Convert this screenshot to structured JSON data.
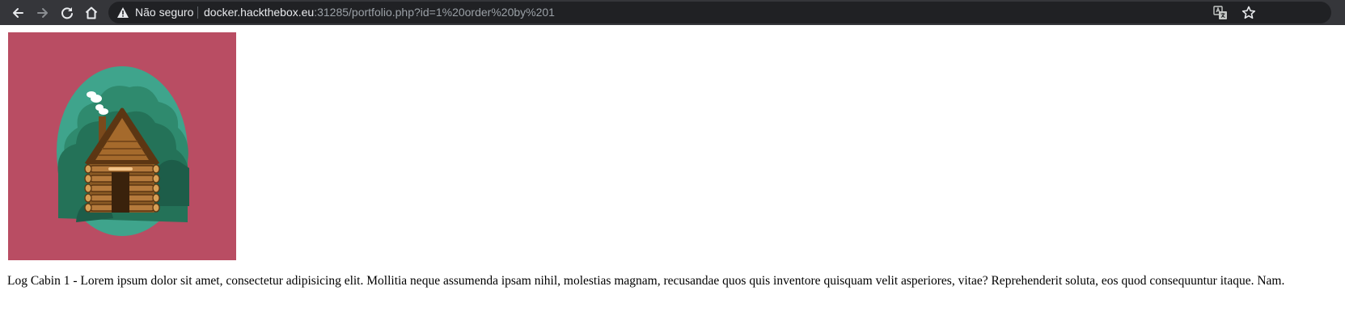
{
  "browser": {
    "security_label": "Não seguro",
    "url_host": "docker.hackthebox.eu",
    "url_rest": ":31285/portfolio.php?id=1%20order%20by%201",
    "icons": [
      "back-icon",
      "forward-icon",
      "reload-icon",
      "home-icon",
      "warning-icon",
      "translate-icon",
      "star-icon"
    ]
  },
  "page": {
    "image_alt": "Log Cabin 1",
    "description": "Log Cabin 1 - Lorem ipsum dolor sit amet, consectetur adipisicing elit. Mollitia neque assumenda ipsam nihil, molestias magnam, recusandae quos quis inventore quisquam velit asperiores, vitae? Reprehenderit soluta, eos quod consequuntur itaque. Nam."
  },
  "colors": {
    "toolbar": "#35363a",
    "omnibox": "#202124",
    "image_bg": "#b94d63",
    "oval": "#3fa48c",
    "cabin": "#8a5a24"
  }
}
